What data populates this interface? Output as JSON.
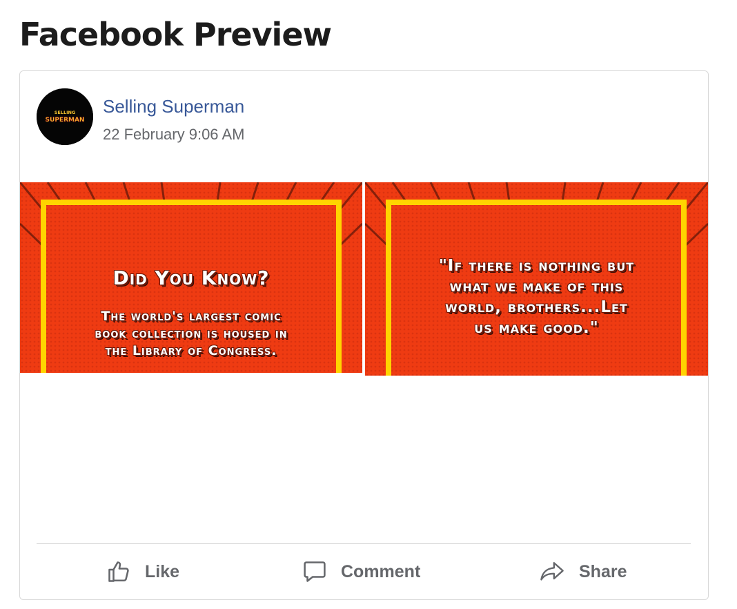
{
  "page": {
    "heading": "Facebook Preview"
  },
  "post": {
    "author": "Selling Superman",
    "timestamp": "22 February 9:06 AM",
    "avatar_logo": {
      "line1": "SELLING",
      "line2": "SUPERMAN"
    },
    "images": [
      {
        "headline": "Did You Know?",
        "body": "The world's largest comic book collection is housed in the Library of Congress."
      },
      {
        "body": "\"If there is nothing but what we make of this world, brothers...Let us make good.\""
      }
    ]
  },
  "actions": {
    "like": {
      "label": "Like",
      "icon": "thumbs-up-icon"
    },
    "comment": {
      "label": "Comment",
      "icon": "speech-bubble-icon"
    },
    "share": {
      "label": "Share",
      "icon": "share-arrow-icon"
    }
  },
  "colors": {
    "author_link": "#385898",
    "muted_text": "#65676b",
    "image_background": "#ef3b12",
    "image_frame": "#ffd400"
  }
}
